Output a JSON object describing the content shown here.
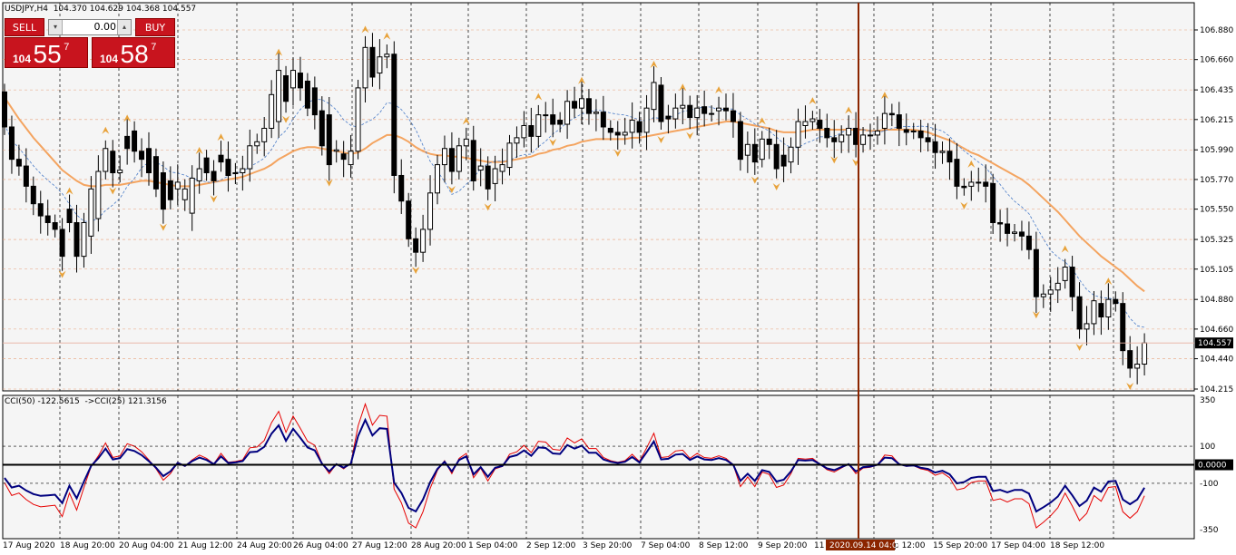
{
  "symbol_line": "USDJPY,H4  104.370 104.629 104.368 104.557",
  "trade_panel": {
    "sell_label": "SELL",
    "buy_label": "BUY",
    "lot": "0.00",
    "sell_prefix": "104",
    "sell_big": "55",
    "sell_sup": "7",
    "buy_prefix": "104",
    "buy_big": "58",
    "buy_sup": "7"
  },
  "indicator_line": "CCI(50) -122.5615  ->CCI(25) 121.3156",
  "price_axis": [
    "106.880",
    "106.660",
    "106.435",
    "106.215",
    "105.990",
    "105.770",
    "105.550",
    "105.325",
    "105.105",
    "104.880",
    "104.660",
    "104.440",
    "104.215"
  ],
  "current_price": "104.557",
  "cci_axis": [
    "350",
    "100",
    "0.0000",
    "-100",
    "-350"
  ],
  "time_axis": [
    "17 Aug 2020",
    "18 Aug 20:00",
    "20 Aug 04:00",
    "21 Aug 12:00",
    "24 Aug 20:00",
    "26 Aug 04:00",
    "27 Aug 12:00",
    "28 Aug 20:00",
    "1 Sep 04:00",
    "2 Sep 12:00",
    "3 Sep 20:00",
    "7 Sep 04:00",
    "8 Sep 12:00",
    "9 Sep 20:00",
    "11",
    "p 12:00",
    "15 Sep 20:00",
    "17 Sep 04:00",
    "18 Sep 12:00"
  ],
  "crosshair_time": "2020.09.14 04:00",
  "colors": {
    "bull_body": "#ffffff",
    "bear_body": "#000000",
    "ma_orange": "#f4a460",
    "ma_blue": "#4a7cc8",
    "cci_red": "#e60000",
    "cci_navy": "#00007f",
    "crosshair": "#8b2500",
    "sell_buy_bg": "#c8141e"
  },
  "chart_data": {
    "type": "candlestick",
    "title": "USDJPY,H4",
    "ylim": [
      104.215,
      106.88
    ],
    "opens": [
      106.42,
      106.16,
      105.92,
      105.87,
      105.72,
      105.59,
      105.5,
      105.45,
      105.4,
      105.55,
      105.45,
      105.2,
      105.35,
      105.48,
      105.83,
      105.98,
      105.82,
      106.09,
      106.13,
      105.98,
      106.0,
      105.94,
      105.82,
      105.76,
      105.7,
      105.62,
      105.52,
      105.76,
      105.93,
      105.83,
      105.95,
      105.92,
      105.82,
      105.82,
      105.85,
      106.02,
      106.05,
      106.15,
      106.2,
      106.54,
      106.45,
      106.56,
      106.5,
      106.45,
      106.28,
      106.25,
      105.98,
      105.96,
      105.88,
      105.98,
      106.45,
      106.75,
      106.56,
      106.68,
      106.7,
      105.8,
      105.61,
      105.33,
      105.23,
      105.4,
      105.67,
      105.88,
      106.0,
      105.83,
      106.02,
      106.06,
      105.84,
      105.87,
      105.74,
      105.83,
      105.86,
      106.04,
      106.08,
      106.17,
      106.09,
      106.25,
      106.25,
      106.21,
      106.18,
      106.35,
      106.3,
      106.37,
      106.26,
      106.27,
      106.15,
      106.12,
      106.1,
      106.12,
      106.2,
      106.12,
      106.29,
      106.47,
      106.24,
      106.22,
      106.3,
      106.32,
      106.23,
      106.31,
      106.26,
      106.28,
      106.3,
      106.28,
      106.2,
      105.95,
      106.03,
      105.92,
      106.07,
      106.03,
      105.95,
      105.9,
      106.01,
      106.17,
      106.2,
      106.21,
      106.15,
      106.08,
      106.05,
      106.1,
      106.15,
      106.03,
      106.1,
      106.1,
      106.15,
      106.26,
      106.25,
      106.14,
      106.13,
      106.13,
      106.08,
      106.05,
      105.97,
      105.98,
      105.92,
      105.72,
      105.72,
      105.75,
      105.75,
      105.74,
      105.45,
      105.44,
      105.37,
      105.38,
      105.35,
      105.25,
      104.9,
      104.92,
      104.95,
      105.02,
      105.12,
      104.9,
      104.66,
      104.7,
      104.85,
      104.75,
      104.88,
      104.85,
      104.5,
      104.37,
      104.4
    ],
    "closes": [
      106.16,
      105.92,
      105.87,
      105.72,
      105.59,
      105.5,
      105.45,
      105.4,
      105.2,
      105.45,
      105.2,
      105.45,
      105.7,
      105.83,
      106.0,
      105.82,
      105.84,
      106.0,
      105.98,
      105.92,
      105.82,
      105.7,
      105.55,
      105.62,
      105.75,
      105.7,
      105.78,
      105.85,
      105.82,
      105.76,
      105.9,
      105.8,
      105.82,
      105.85,
      106.02,
      106.05,
      106.15,
      106.4,
      106.58,
      106.35,
      106.58,
      106.45,
      106.3,
      106.25,
      106.02,
      105.88,
      105.99,
      105.92,
      105.98,
      106.45,
      106.75,
      106.53,
      106.68,
      106.7,
      105.8,
      105.61,
      105.33,
      105.23,
      105.4,
      105.67,
      105.88,
      106.0,
      105.83,
      106.02,
      106.07,
      105.76,
      105.87,
      105.7,
      105.85,
      105.88,
      106.04,
      106.08,
      106.17,
      106.09,
      106.25,
      106.25,
      106.18,
      106.18,
      106.35,
      106.3,
      106.37,
      106.26,
      106.27,
      106.16,
      106.12,
      106.1,
      106.12,
      106.21,
      106.12,
      106.3,
      106.49,
      106.2,
      106.22,
      106.3,
      106.32,
      106.23,
      106.3,
      106.26,
      106.26,
      106.3,
      106.28,
      106.2,
      105.92,
      106.03,
      105.9,
      106.07,
      106.03,
      105.85,
      105.87,
      106.01,
      106.2,
      106.2,
      106.22,
      106.15,
      106.08,
      106.05,
      106.1,
      106.15,
      106.03,
      106.1,
      106.1,
      106.13,
      106.26,
      106.25,
      106.15,
      106.12,
      106.13,
      106.08,
      106.05,
      105.97,
      105.98,
      105.9,
      105.72,
      105.71,
      105.75,
      105.75,
      105.72,
      105.45,
      105.44,
      105.37,
      105.38,
      105.35,
      105.25,
      104.9,
      104.92,
      104.95,
      105.0,
      105.12,
      104.9,
      104.66,
      104.7,
      104.87,
      104.75,
      104.88,
      104.85,
      104.5,
      104.37,
      104.4,
      104.557
    ],
    "ma_slow": [
      106.38,
      106.3,
      106.22,
      106.15,
      106.08,
      106.02,
      105.96,
      105.9,
      105.84,
      105.8,
      105.76,
      105.73,
      105.72,
      105.72,
      105.73,
      105.73,
      105.73,
      105.74,
      105.75,
      105.76,
      105.76,
      105.75,
      105.74,
      105.73,
      105.72,
      105.72,
      105.72,
      105.73,
      105.74,
      105.75,
      105.76,
      105.77,
      105.78,
      105.79,
      105.81,
      105.83,
      105.85,
      105.88,
      105.92,
      105.95,
      105.98,
      106.0,
      106.01,
      106.01,
      106.0,
      105.99,
      105.98,
      105.97,
      105.96,
      105.97,
      106.0,
      106.04,
      106.07,
      106.1,
      106.1,
      106.08,
      106.05,
      106.01,
      105.98,
      105.96,
      105.95,
      105.95,
      105.94,
      105.94,
      105.93,
      105.92,
      105.91,
      105.9,
      105.9,
      105.9,
      105.91,
      105.92,
      105.93,
      105.94,
      105.96,
      105.97,
      105.99,
      106.0,
      106.02,
      106.03,
      106.05,
      106.06,
      106.07,
      106.07,
      106.07,
      106.07,
      106.07,
      106.08,
      106.08,
      106.09,
      106.1,
      106.11,
      106.12,
      106.13,
      106.14,
      106.15,
      106.16,
      106.17,
      106.18,
      106.19,
      106.2,
      106.2,
      106.19,
      106.18,
      106.17,
      106.16,
      106.15,
      106.13,
      106.12,
      106.12,
      106.12,
      106.13,
      106.14,
      106.14,
      106.14,
      106.14,
      106.14,
      106.14,
      106.14,
      106.14,
      106.13,
      106.13,
      106.14,
      106.14,
      106.14,
      106.14,
      106.14,
      106.13,
      106.12,
      106.1,
      106.08,
      106.06,
      106.03,
      106.0,
      105.97,
      105.95,
      105.92,
      105.89,
      105.86,
      105.83,
      105.8,
      105.77,
      105.73,
      105.68,
      105.63,
      105.58,
      105.53,
      105.47,
      105.41,
      105.35,
      105.3,
      105.25,
      105.2,
      105.16,
      105.12,
      105.08,
      105.03,
      104.98,
      104.94
    ]
  }
}
